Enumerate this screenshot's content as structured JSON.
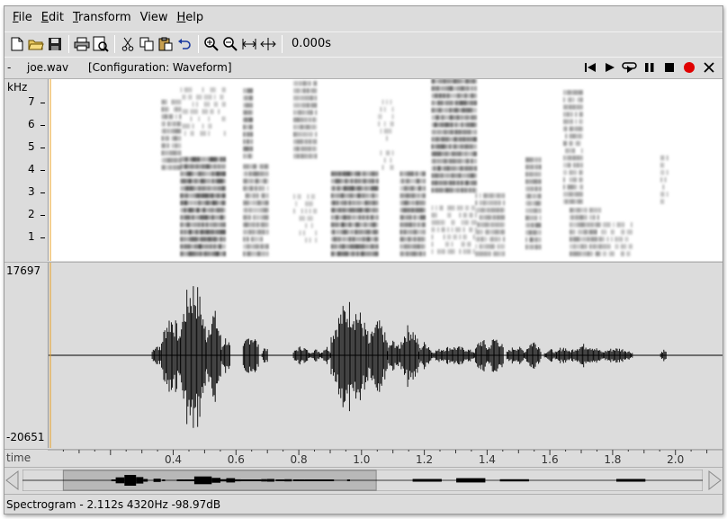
{
  "menu": [
    {
      "label": "File",
      "mnemonic": "F",
      "rest": "ile"
    },
    {
      "label": "Edit",
      "mnemonic": "E",
      "rest": "dit"
    },
    {
      "label": "Transform",
      "mnemonic": "T",
      "rest": "ransform"
    },
    {
      "label": "View",
      "mnemonic": "",
      "rest": "View"
    },
    {
      "label": "Help",
      "mnemonic": "H",
      "rest": "elp"
    }
  ],
  "toolbar": {
    "time_readout": "0.000s",
    "icons": [
      "new-file-icon",
      "open-folder-icon",
      "save-icon",
      "print-icon",
      "print-preview-icon",
      "cut-icon",
      "copy-icon",
      "paste-icon",
      "undo-icon",
      "zoom-in-icon",
      "zoom-out-icon",
      "zoom-fit-icon",
      "zoom-selection-icon"
    ]
  },
  "infobar": {
    "dash": "-",
    "filename": "joe.wav",
    "configuration": "[Configuration: Waveform]"
  },
  "transport": [
    "skip-to-start-icon",
    "play-icon",
    "loop-play-icon",
    "pause-icon",
    "stop-icon",
    "record-icon",
    "close-icon"
  ],
  "spectrogram": {
    "unit_label": "kHz",
    "ticks": [
      "7",
      "6",
      "5",
      "4",
      "3",
      "2",
      "1"
    ],
    "tick_values": [
      7,
      6,
      5,
      4,
      3,
      2,
      1
    ],
    "max_khz": 8
  },
  "waveform": {
    "max_label": "17697",
    "min_label": "-20651"
  },
  "ruler": {
    "label": "time",
    "ticks": [
      "0.4",
      "0.6",
      "0.8",
      "1.0",
      "1.2",
      "1.4",
      "1.6",
      "1.8",
      "2.0"
    ],
    "tick_values": [
      0.4,
      0.6,
      0.8,
      1.0,
      1.2,
      1.4,
      1.6,
      1.8,
      2.0
    ],
    "view_start": 0.0,
    "view_end": 2.15
  },
  "overview": {
    "view_fraction_start": 0.06,
    "view_fraction_end": 0.52
  },
  "status": {
    "text": "Spectrogram - 2.112s 4320Hz -98.97dB"
  },
  "colors": {
    "panel_bg": "#dcdcdc",
    "cursor": "#e8a020",
    "record": "#e00000"
  }
}
